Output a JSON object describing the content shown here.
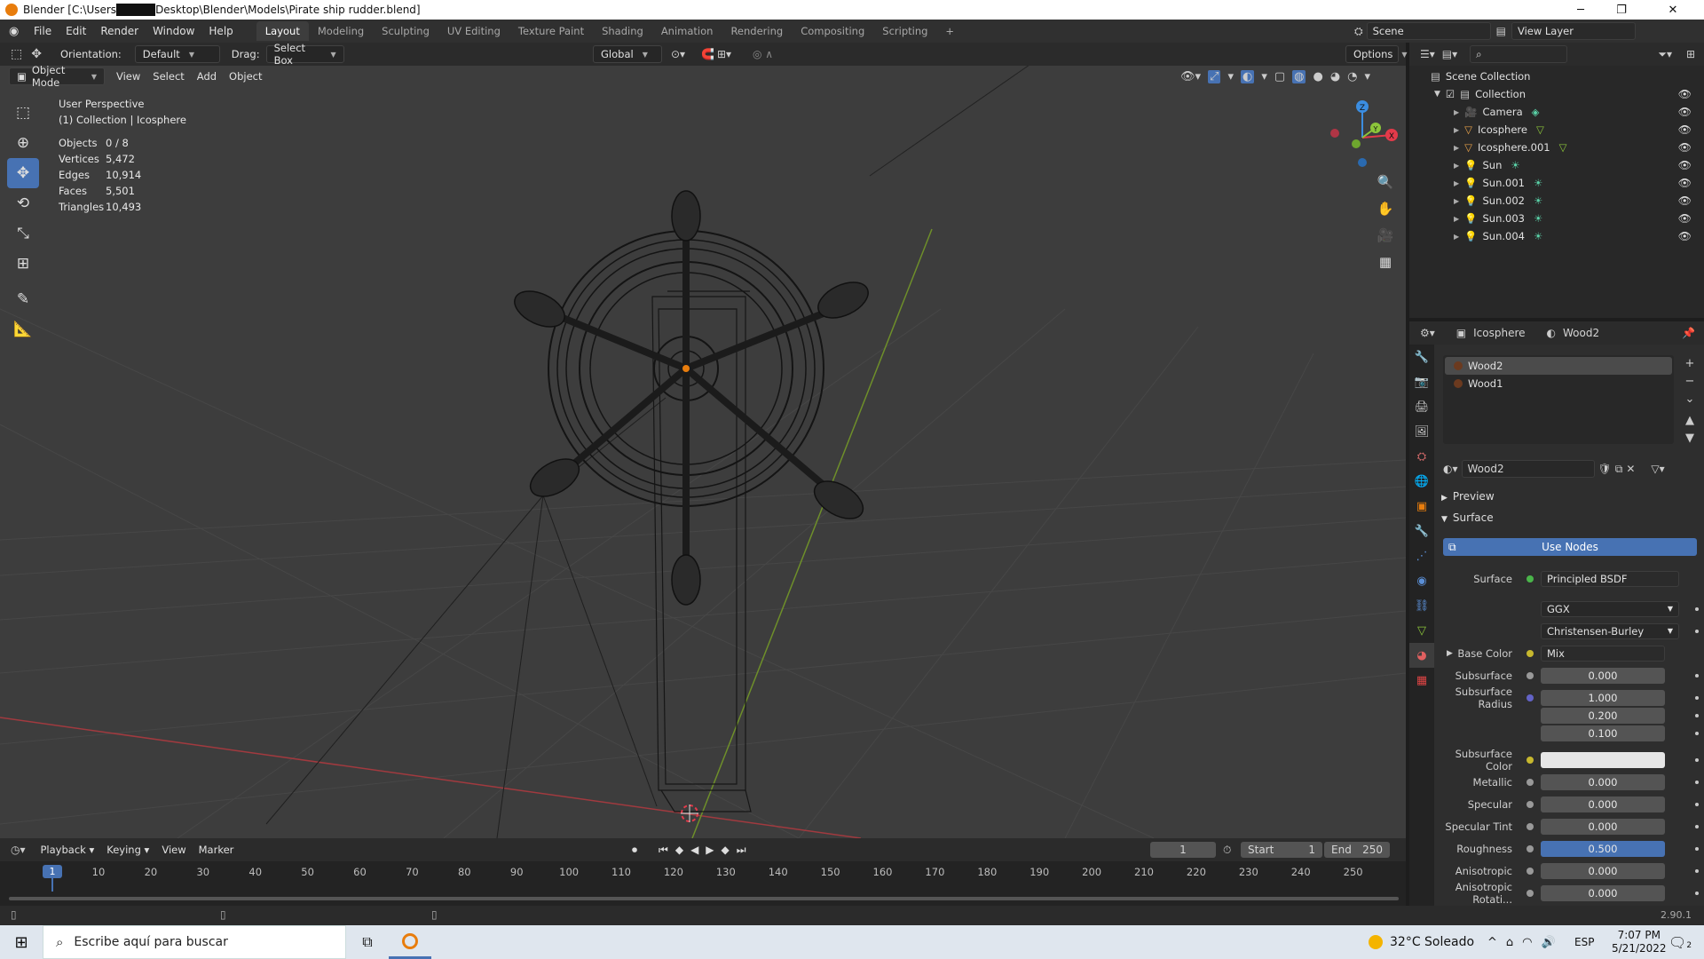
{
  "title": {
    "prefix": "Blender [C:\\Users",
    "suffix": "Desktop\\Blender\\Models\\Pirate ship rudder.blend]"
  },
  "menu": [
    "File",
    "Edit",
    "Render",
    "Window",
    "Help"
  ],
  "workspaces": [
    "Layout",
    "Modeling",
    "Sculpting",
    "UV Editing",
    "Texture Paint",
    "Shading",
    "Animation",
    "Rendering",
    "Compositing",
    "Scripting",
    "+"
  ],
  "scene": "Scene",
  "view_layer": "View Layer",
  "tool_header": {
    "orientation_label": "Orientation:",
    "orientation": "Default",
    "drag_label": "Drag:",
    "drag": "Select Box",
    "transform": "Global",
    "options": "Options"
  },
  "vp_header": {
    "mode": "Object Mode",
    "items": [
      "View",
      "Select",
      "Add",
      "Object"
    ]
  },
  "overlay": {
    "view_name": "User Perspective",
    "collection": "(1) Collection | Icosphere",
    "stats": [
      {
        "k": "Objects",
        "v": "0 / 8"
      },
      {
        "k": "Vertices",
        "v": "5,472"
      },
      {
        "k": "Edges",
        "v": "10,914"
      },
      {
        "k": "Faces",
        "v": "5,501"
      },
      {
        "k": "Triangles",
        "v": "10,493"
      }
    ]
  },
  "gizmo": {
    "x": "X",
    "y": "Y",
    "z": "Z"
  },
  "timeline": {
    "menus": [
      "Playback",
      "Keying",
      "View",
      "Marker"
    ],
    "current_frame": "1",
    "start_label": "Start",
    "start": "1",
    "end_label": "End",
    "end": "250",
    "ruler": [
      "1",
      "10",
      "20",
      "30",
      "40",
      "50",
      "60",
      "70",
      "80",
      "90",
      "100",
      "110",
      "120",
      "130",
      "140",
      "150",
      "160",
      "170",
      "180",
      "190",
      "200",
      "210",
      "220",
      "230",
      "240",
      "250"
    ]
  },
  "version": "2.90.1",
  "outliner": {
    "root": "Scene Collection",
    "collection": "Collection",
    "objects": [
      {
        "name": "Camera",
        "type": "camera"
      },
      {
        "name": "Icosphere",
        "type": "mesh"
      },
      {
        "name": "Icosphere.001",
        "type": "mesh"
      },
      {
        "name": "Sun",
        "type": "light"
      },
      {
        "name": "Sun.001",
        "type": "light"
      },
      {
        "name": "Sun.002",
        "type": "light"
      },
      {
        "name": "Sun.003",
        "type": "light"
      },
      {
        "name": "Sun.004",
        "type": "light"
      }
    ]
  },
  "properties": {
    "object": "Icosphere",
    "material": "Wood2",
    "slots": [
      "Wood2",
      "Wood1"
    ],
    "material_field": "Wood2",
    "panels": {
      "preview": "Preview",
      "surface": "Surface"
    },
    "use_nodes": "Use Nodes",
    "surface_label": "Surface",
    "surface_shader": "Principled BSDF",
    "distribution": "GGX",
    "subsurface_method": "Christensen-Burley",
    "base_color_label": "Base Color",
    "base_color": "Mix",
    "fields": [
      {
        "label": "Subsurface",
        "value": "0.000"
      },
      {
        "label": "Subsurface Radius",
        "value": "1.000"
      },
      {
        "label": "",
        "value": "0.200"
      },
      {
        "label": "",
        "value": "0.100"
      },
      {
        "label": "Subsurface Color",
        "value": ""
      },
      {
        "label": "Metallic",
        "value": "0.000"
      },
      {
        "label": "Specular",
        "value": "0.000"
      },
      {
        "label": "Specular Tint",
        "value": "0.000"
      },
      {
        "label": "Roughness",
        "value": "0.500"
      },
      {
        "label": "Anisotropic",
        "value": "0.000"
      },
      {
        "label": "Anisotropic Rotati...",
        "value": "0.000"
      }
    ]
  },
  "taskbar": {
    "search": "Escribe aquí para buscar",
    "weather": "32°C  Soleado",
    "lang": "ESP",
    "time": "7:07 PM",
    "date": "5/21/2022",
    "notif": "2"
  },
  "colors": {
    "accent": "#4772b3",
    "x_axis": "#e33a4a",
    "y_axis": "#8cc63a",
    "z_axis": "#3b8de0",
    "orange": "#e87d0d"
  }
}
